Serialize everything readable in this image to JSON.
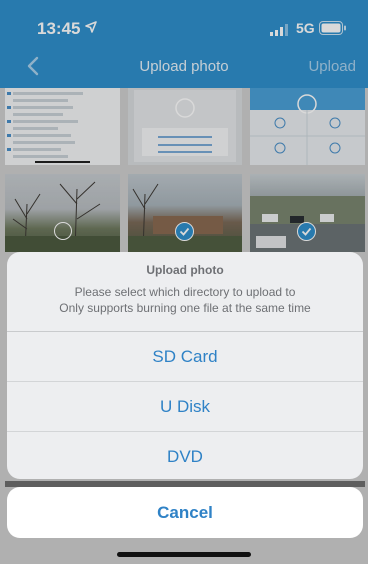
{
  "status_bar": {
    "time": "13:45",
    "network": "5G"
  },
  "nav": {
    "title": "Upload photo",
    "upload_label": "Upload"
  },
  "icons": {
    "location": "location-arrow-icon",
    "signal": "signal-bars-icon",
    "battery": "battery-icon",
    "back": "chevron-left-icon",
    "check": "checkmark-icon"
  },
  "colors": {
    "accent": "#2f90cd",
    "link": "#2f82c6"
  },
  "sheet": {
    "title": "Upload photo",
    "message_line1": "Please select which directory to upload to",
    "message_line2": "Only supports burning one file at the same time",
    "options": [
      "SD Card",
      "U Disk",
      "DVD"
    ],
    "cancel_label": "Cancel"
  }
}
